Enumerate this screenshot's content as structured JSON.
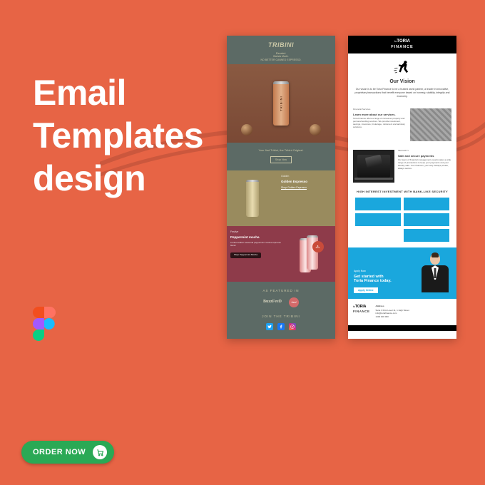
{
  "headline": "Email\nTemplates\ndesign",
  "order_button": "ORDER NOW",
  "tribini": {
    "brand": "TRIBINI",
    "sub_lines": "Elevated.\nBarista Made.\nNO BETTER CANNED ESPRESSO.",
    "can_label": "TRIBINI",
    "cta1_line": "Your first Tribini, the Tribini Original.",
    "cta1_button": "Shop Now",
    "row2": {
      "kicker": "Golden",
      "title": "Golden Espresso",
      "cta": "Shop Golden Espresso"
    },
    "row3": {
      "kicker": "Festive",
      "title": "Peppermint mocha",
      "body": "Limited edition seasonal peppermint mocha espresso blend.",
      "cta": "Shop Peppermint Mocha",
      "badge_top": "8",
      "badge_bot": "PACK"
    },
    "featured_h": "AS FEATURED IN",
    "brand1": "BuzzFeeD",
    "brand2": "food",
    "join": "JOIN THE TRIBINI"
  },
  "toria": {
    "logo_prefix": "to",
    "logo1": "TORIA",
    "logo2": "FINANCE",
    "vision_h": "Our Vision",
    "vision_p": "Our vision is to be Toria Finance to be a trusted world partner, a leader in innovative, proprietary transactions that benefit everyone based on honesty, stability, integrity and economy.",
    "sec1": {
      "kicker": "Financial Services",
      "title": "Learn more about our services.",
      "body": "Toria Finance offers a range of consumer property and personal lending services. We provide investment, savings, insurance, brokerage, retirement and advisory solutions."
    },
    "sec2": {
      "kicker": "SECURITY",
      "title": "Safe and secure payments",
      "body": "Our team of financial management experts takes a wide range of precautions to keep your payments and your identity safe. Your finances, your way. Always private, always secure."
    },
    "grid_h": "HIGH INTEREST INVESTMENT WITH BANK-LIKE SECURITY",
    "boxes": [
      "",
      "",
      "",
      "",
      ""
    ],
    "apply": {
      "kicker": "Apply Now",
      "title": "Get started with\nToria Finance today.",
      "button": "Apply Online"
    },
    "footer": {
      "addr_h": "Address",
      "addr": "Suite 3 First Level 11, 1 High Street",
      "email": "info@toriafinance.com",
      "phone": "1300 000 000"
    }
  }
}
